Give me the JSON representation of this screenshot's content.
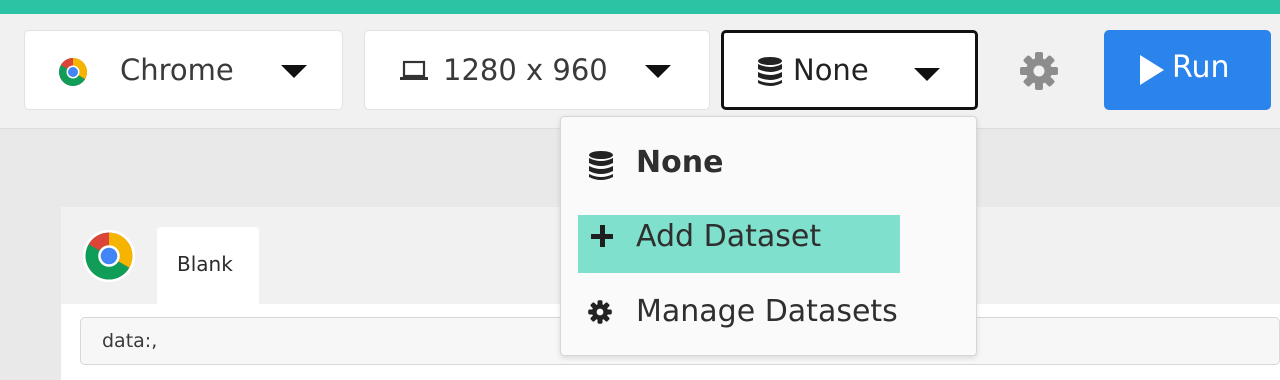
{
  "toolbar": {
    "browser": {
      "label": "Chrome",
      "icon": "chrome-icon"
    },
    "resolution": {
      "label": "1280 x 960",
      "icon": "laptop-icon"
    },
    "dataset": {
      "label": "None",
      "icon": "database-icon"
    },
    "settings": {
      "icon": "gear-icon"
    },
    "run": {
      "label": "Run",
      "icon": "play-icon"
    }
  },
  "dataset_menu": {
    "items": [
      {
        "label": "None",
        "icon": "database-icon"
      },
      {
        "label": "Add Dataset",
        "icon": "plus-icon",
        "highlighted": true
      },
      {
        "label": "Manage Datasets",
        "icon": "gear-icon"
      }
    ]
  },
  "preview": {
    "tab_title": "Blank",
    "address": "data:,"
  },
  "colors": {
    "accent_bar": "#2cc3a4",
    "run_button": "#2b83ec",
    "menu_highlight": "#7fe0cd"
  }
}
